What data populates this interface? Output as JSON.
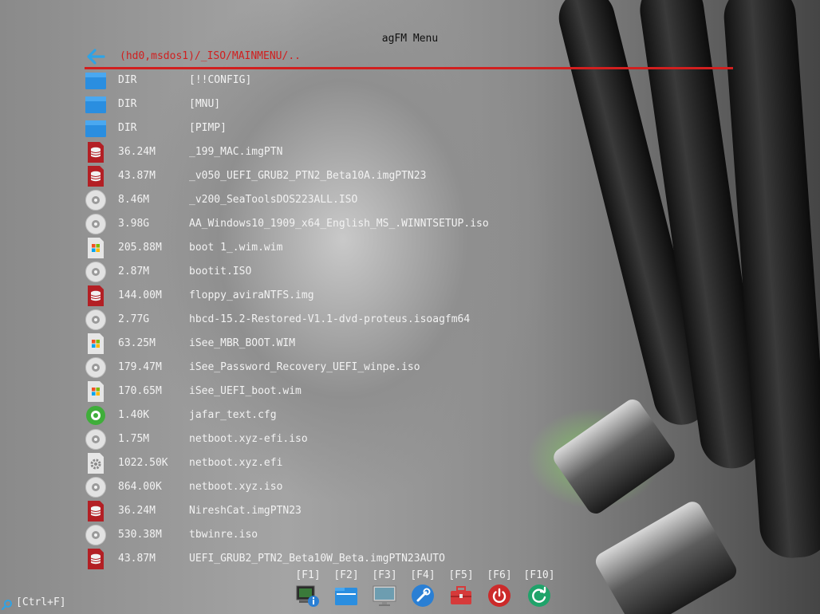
{
  "title": "agFM Menu",
  "path": "(hd0,msdos1)/_ISO/MAINMENU/..",
  "files": [
    {
      "icon": "folder-icon",
      "size": "DIR",
      "name": "[!!CONFIG]"
    },
    {
      "icon": "folder-icon",
      "size": "DIR",
      "name": "[MNU]"
    },
    {
      "icon": "folder-icon",
      "size": "DIR",
      "name": "[PIMP]"
    },
    {
      "icon": "disk-image-icon",
      "size": "36.24M",
      "name": "_199_MAC.imgPTN"
    },
    {
      "icon": "disk-image-icon",
      "size": "43.87M",
      "name": "_v050_UEFI_GRUB2_PTN2_Beta10A.imgPTN23"
    },
    {
      "icon": "cd-icon",
      "size": "8.46M",
      "name": "_v200_SeaToolsDOS223ALL.ISO"
    },
    {
      "icon": "cd-icon",
      "size": "3.98G",
      "name": "AA_Windows10_1909_x64_English_MS_.WINNTSETUP.iso"
    },
    {
      "icon": "wim-icon",
      "size": "205.88M",
      "name": "boot 1_.wim.wim"
    },
    {
      "icon": "cd-icon",
      "size": "2.87M",
      "name": "bootit.ISO"
    },
    {
      "icon": "disk-image-icon",
      "size": "144.00M",
      "name": "floppy_aviraNTFS.img"
    },
    {
      "icon": "cd-icon",
      "size": "2.77G",
      "name": "hbcd-15.2-Restored-V1.1-dvd-proteus.isoagfm64"
    },
    {
      "icon": "wim-icon",
      "size": "63.25M",
      "name": "iSee_MBR_BOOT.WIM"
    },
    {
      "icon": "cd-icon",
      "size": "179.47M",
      "name": "iSee_Password_Recovery_UEFI_winpe.iso"
    },
    {
      "icon": "wim-icon",
      "size": "170.65M",
      "name": "iSee_UEFI_boot.wim"
    },
    {
      "icon": "config-icon",
      "size": "1.40K",
      "name": "jafar_text.cfg"
    },
    {
      "icon": "cd-icon",
      "size": "1.75M",
      "name": "netboot.xyz-efi.iso"
    },
    {
      "icon": "efi-gear-icon",
      "size": "1022.50K",
      "name": "netboot.xyz.efi"
    },
    {
      "icon": "cd-icon",
      "size": "864.00K",
      "name": "netboot.xyz.iso"
    },
    {
      "icon": "disk-image-icon",
      "size": "36.24M",
      "name": "NireshCat.imgPTN23"
    },
    {
      "icon": "cd-icon",
      "size": "530.38M",
      "name": "tbwinre.iso"
    },
    {
      "icon": "disk-image-icon",
      "size": "43.87M",
      "name": "UEFI_GRUB2_PTN2_Beta10W_Beta.imgPTN23AUTO"
    }
  ],
  "function_keys": [
    {
      "key": "[F1]",
      "icon": "system-info-icon"
    },
    {
      "key": "[F2]",
      "icon": "file-manager-icon"
    },
    {
      "key": "[F3]",
      "icon": "display-icon"
    },
    {
      "key": "[F4]",
      "icon": "settings-icon"
    },
    {
      "key": "[F5]",
      "icon": "toolbox-icon"
    },
    {
      "key": "[F6]",
      "icon": "power-icon"
    },
    {
      "key": "[F10]",
      "icon": "reboot-icon"
    }
  ],
  "search_hint": "[Ctrl+F]",
  "colors": {
    "path_text": "#d02020",
    "rule": "#d11f1f",
    "list_text": "#f2f2f2",
    "title_text": "#101010"
  }
}
